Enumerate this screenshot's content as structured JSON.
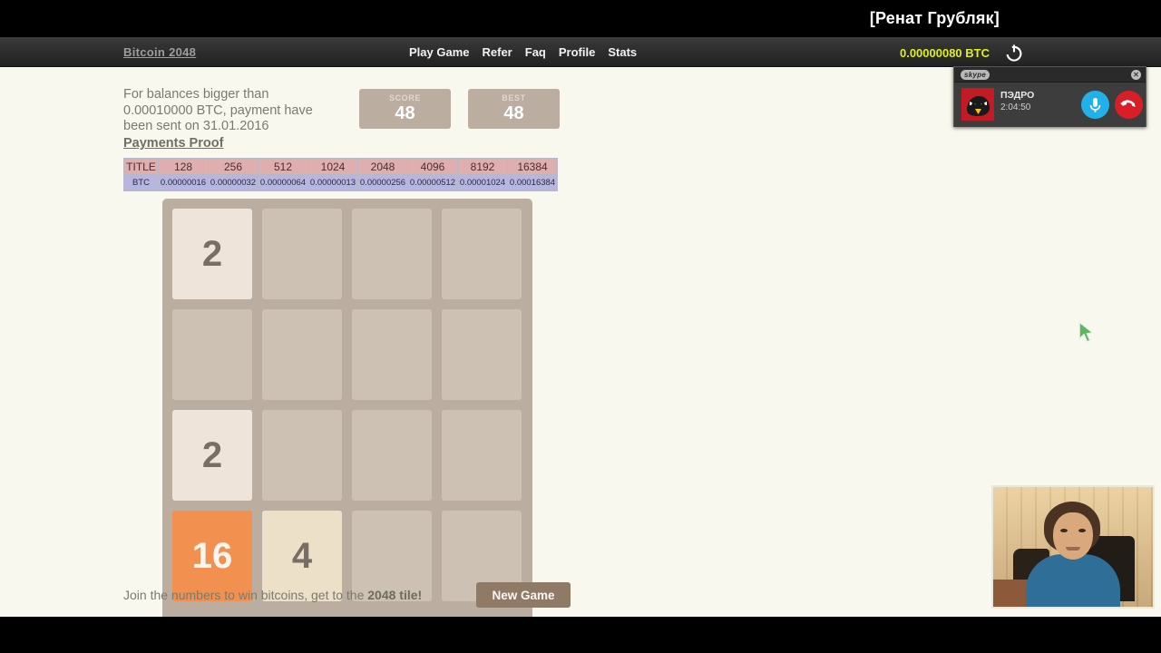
{
  "stream": {
    "title": "[Ренат Грубляк]"
  },
  "navbar": {
    "brand": "Bitcoin 2048",
    "links": [
      {
        "label": "Play Game",
        "name": "nav-play-game"
      },
      {
        "label": "Refer",
        "name": "nav-refer"
      },
      {
        "label": "Faq",
        "name": "nav-faq"
      },
      {
        "label": "Profile",
        "name": "nav-profile"
      },
      {
        "label": "Stats",
        "name": "nav-stats"
      }
    ],
    "balance": "0.00000080 BTC",
    "balance_color": "#ddee22",
    "power_icon": "power-icon"
  },
  "info": {
    "notice_line1": "For balances bigger than",
    "notice_line2": "0.00010000 BTC, payment have",
    "notice_line3": "been sent on 31.01.2016",
    "payments_proof_link": "Payments Proof"
  },
  "scores": {
    "score_label": "SCORE",
    "score_value": "48",
    "best_label": "BEST",
    "best_value": "48"
  },
  "payout_table": {
    "header": [
      "TITLE",
      "128",
      "256",
      "512",
      "1024",
      "2048",
      "4096",
      "8192",
      "16384"
    ],
    "rows": [
      [
        "BTC",
        "0.00000016",
        "0.00000032",
        "0.00000064",
        "0.00000013",
        "0.00000256",
        "0.00000512",
        "0.00001024",
        "0.00016384"
      ]
    ],
    "header_bg": "#dfaeae",
    "row_bg": "#b6b6de"
  },
  "board": {
    "tiles": [
      [
        "2",
        "",
        "",
        ""
      ],
      [
        "",
        "",
        "",
        ""
      ],
      [
        "2",
        "",
        "",
        ""
      ],
      [
        "16",
        "4",
        "",
        ""
      ]
    ],
    "board_bg": "#bbada0",
    "cell_bg": "#cdc1b4"
  },
  "footer": {
    "note_prefix": "Join the numbers to win bitcoins, get to the ",
    "note_strong": "2048 tile!",
    "new_game_label": "New Game"
  },
  "skype": {
    "logo": "skype",
    "close_icon": "close-icon",
    "caller": "ПЭДРО",
    "timer": "2:04:50",
    "mic_icon": "microphone-icon",
    "hangup_icon": "hangup-icon",
    "avatar": "angry-birds-avatar"
  },
  "webcam": {
    "label": "webcam-feed"
  },
  "cursor": {
    "label": "mouse-cursor"
  }
}
